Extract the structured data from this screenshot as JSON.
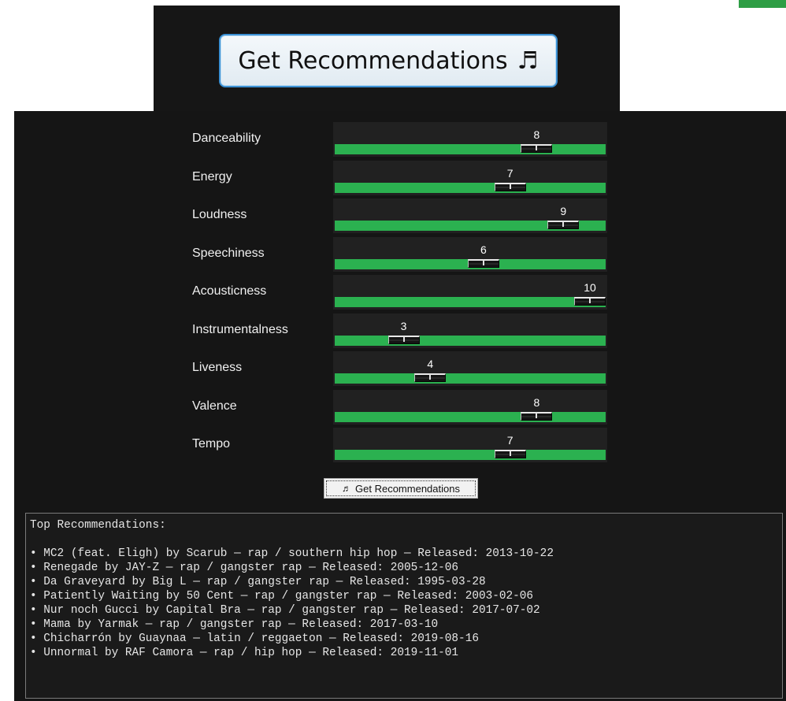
{
  "header_button": {
    "label": "Get Recommendations",
    "icon": "music-note-icon",
    "glyph": "♬"
  },
  "sliders": [
    {
      "label": "Danceability",
      "value": 8,
      "min": 1,
      "max": 10
    },
    {
      "label": "Energy",
      "value": 7,
      "min": 1,
      "max": 10
    },
    {
      "label": "Loudness",
      "value": 9,
      "min": 1,
      "max": 10
    },
    {
      "label": "Speechiness",
      "value": 6,
      "min": 1,
      "max": 10
    },
    {
      "label": "Acousticness",
      "value": 10,
      "min": 1,
      "max": 10
    },
    {
      "label": "Instrumentalness",
      "value": 3,
      "min": 1,
      "max": 10
    },
    {
      "label": "Liveness",
      "value": 4,
      "min": 1,
      "max": 10
    },
    {
      "label": "Valence",
      "value": 8,
      "min": 1,
      "max": 10
    },
    {
      "label": "Tempo",
      "value": 7,
      "min": 1,
      "max": 10
    }
  ],
  "action_button": {
    "label": "Get Recommendations",
    "icon": "music-note-icon",
    "glyph": "♬"
  },
  "results": {
    "heading": "Top Recommendations:",
    "items": [
      "• MC2 (feat. Eligh) by Scarub — rap / southern hip hop — Released: 2013-10-22",
      "• Renegade by JAY-Z — rap / gangster rap — Released: 2005-12-06",
      "• Da Graveyard by Big L — rap / gangster rap — Released: 1995-03-28",
      "• Patiently Waiting by 50 Cent — rap / gangster rap — Released: 2003-02-06",
      "• Nur noch Gucci by Capital Bra — rap / gangster rap — Released: 2017-07-02",
      "• Mama by Yarmak — rap / gangster rap — Released: 2017-03-10",
      "• Chicharrón by Guaynaa — latin / reggaeton — Released: 2019-08-16",
      "• Unnormal by RAF Camora — rap / hip hop — Released: 2019-11-01"
    ]
  },
  "colors": {
    "panel_bg": "#151515",
    "track_fill": "#2bb150",
    "accent_blue": "#3c91d4",
    "corner_green": "#2e9e45"
  }
}
